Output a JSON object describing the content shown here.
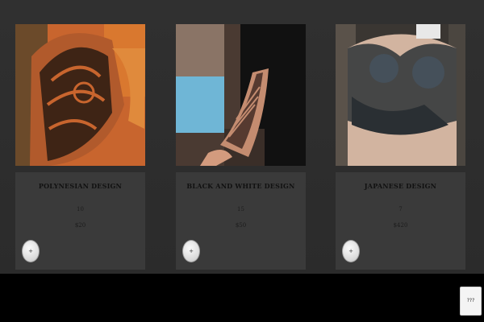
{
  "products": [
    {
      "title": "Polynesian Design",
      "count": "10",
      "price": "$20",
      "add_label": "+",
      "photo_icon": "polynesian-tattoo-photo"
    },
    {
      "title": "Black and White Design",
      "count": "15",
      "price": "$50",
      "add_label": "+",
      "photo_icon": "black-white-tattoo-photo"
    },
    {
      "title": "Japanese Design",
      "count": "7",
      "price": "$420",
      "add_label": "+",
      "photo_icon": "japanese-tattoo-photo"
    }
  ],
  "help": {
    "label": "???"
  },
  "colors": {
    "page_bg": "#2e2e2e",
    "card_bg": "#3a3a3a",
    "footer_bg": "#000000"
  }
}
